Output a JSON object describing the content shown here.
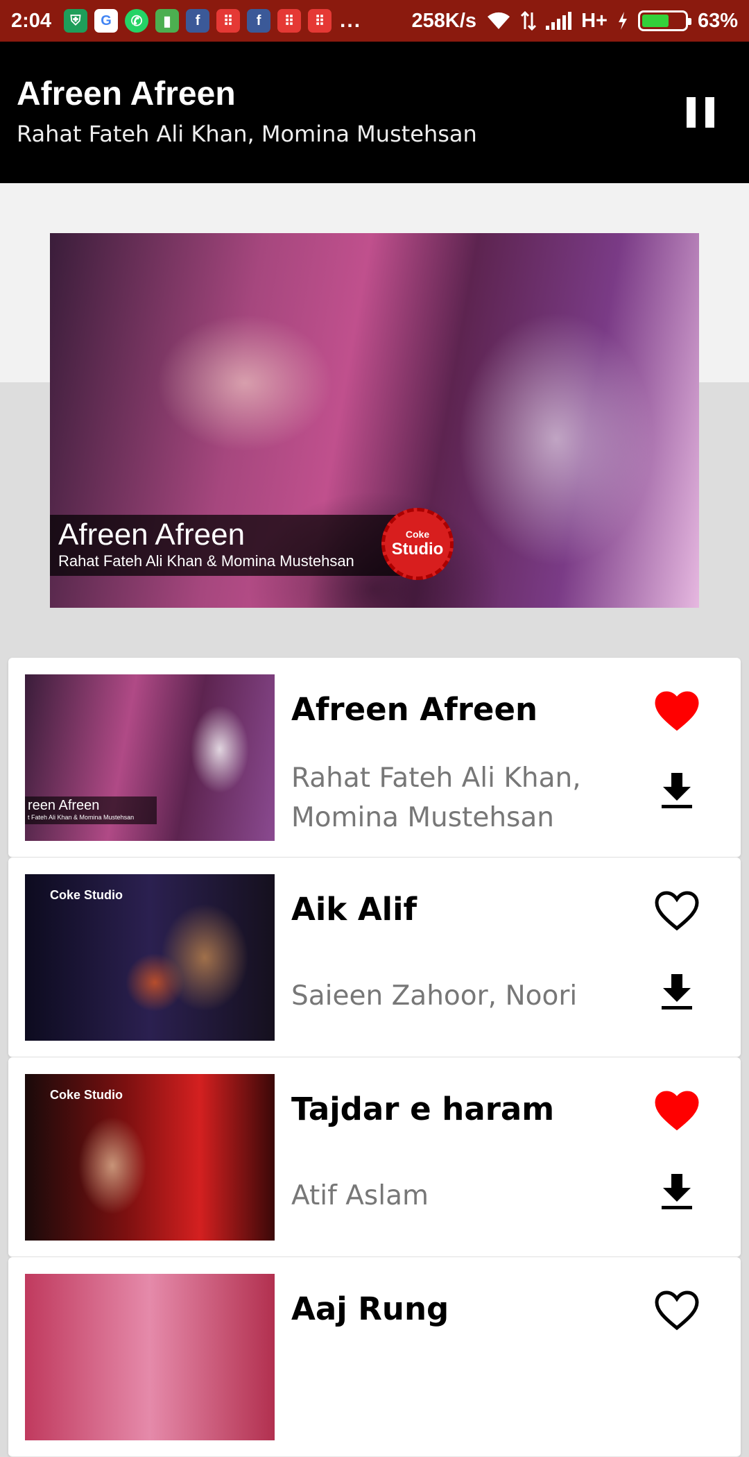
{
  "status_bar": {
    "time": "2:04",
    "network_speed": "258K/s",
    "network_type": "H+",
    "battery_percent": "63%",
    "battery_level": 0.63,
    "notification_icons": [
      "shield-icon",
      "google-icon",
      "whatsapp-icon",
      "battery-app-icon",
      "facebook-icon",
      "grid-app-icon",
      "facebook-icon",
      "grid-app-icon",
      "grid-app-icon"
    ],
    "overflow": "..."
  },
  "now_playing": {
    "title": "Afreen Afreen",
    "artist": "Rahat Fateh Ali Khan, Momina Mustehsan",
    "control_icon": "pause-icon"
  },
  "hero": {
    "caption_title": "Afreen Afreen",
    "caption_subtitle": "Rahat Fateh Ali Khan & Momina Mustehsan",
    "logo_line1": "Coke",
    "logo_line2": "Studio"
  },
  "songs": [
    {
      "title": "Afreen Afreen",
      "artist": "Rahat Fateh Ali Khan, Momina Mustehsan",
      "favorited": true,
      "thumb_caption": "reen Afreen",
      "thumb_sub": "t Fateh Ali Khan & Momina Mustehsan"
    },
    {
      "title": "Aik Alif",
      "artist": "Saieen Zahoor, Noori",
      "favorited": false,
      "thumb_logo": "Coke Studio"
    },
    {
      "title": "Tajdar e haram",
      "artist": "Atif Aslam",
      "favorited": true,
      "thumb_logo": "Coke Studio"
    },
    {
      "title": "Aaj Rung",
      "artist": "",
      "favorited": false
    }
  ],
  "colors": {
    "status_bar": "#8b1a0e",
    "header": "#000000",
    "favorite_active": "#ff0000",
    "artist_text": "#777777"
  }
}
